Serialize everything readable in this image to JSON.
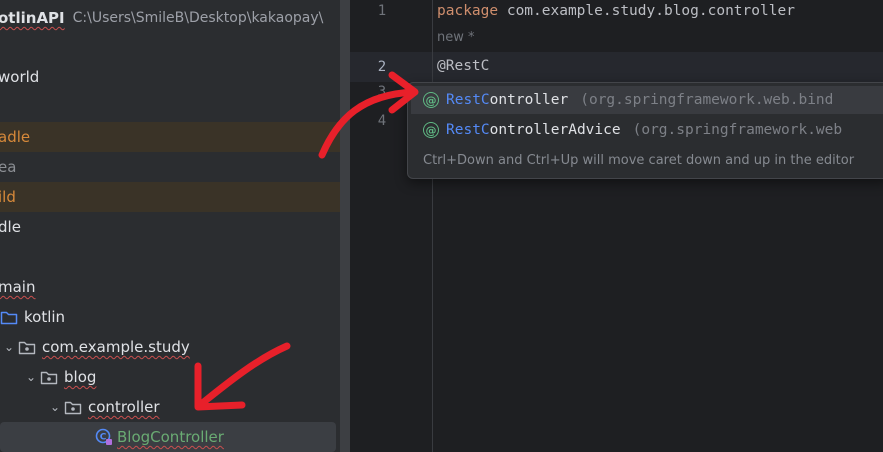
{
  "project_panel": {
    "project_name": "otlinAPI",
    "project_path": "C:\\Users\\SmileB\\Desktop\\kakaopay\\",
    "rows": [
      {
        "label": "world"
      },
      {
        "label": "adle"
      },
      {
        "label": "ea"
      },
      {
        "label": "ild"
      },
      {
        "label": "dle"
      },
      {
        "label": "main"
      },
      {
        "label": "kotlin"
      },
      {
        "label": "com.example.study"
      },
      {
        "label": "blog"
      },
      {
        "label": "controller"
      },
      {
        "label": "BlogController"
      }
    ]
  },
  "editor": {
    "line_numbers": [
      "1",
      "2",
      "3",
      "4"
    ],
    "line1_keyword": "package",
    "line1_rest": " com.example.study.blog.controller",
    "inlay_hint": "new *",
    "line2_text": "@RestC"
  },
  "completion": {
    "items": [
      {
        "match": "RestC",
        "rest": "ontroller",
        "package": "(org.springframework.web.bind"
      },
      {
        "match": "RestC",
        "rest": "ontrollerAdvice",
        "package": "(org.springframework.web"
      }
    ],
    "hint": "Ctrl+Down and Ctrl+Up will move caret down and up in the editor"
  },
  "colors": {
    "arrow": "#e8202a",
    "accent_blue": "#548af7",
    "keyword_orange": "#cf8e6d"
  }
}
